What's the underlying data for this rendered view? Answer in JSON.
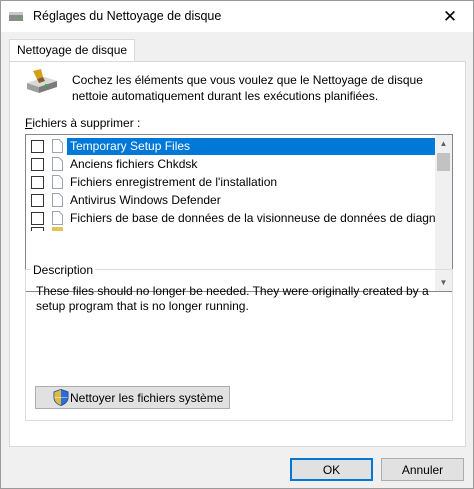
{
  "window": {
    "title": "Réglages du Nettoyage de disque",
    "close_glyph": "✕"
  },
  "tab": {
    "label": "Nettoyage de disque"
  },
  "intro": "Cochez les éléments que vous voulez que le Nettoyage de disque nettoie automatiquement durant les exécutions planifiées.",
  "files": {
    "label_prefix": "",
    "label_accel": "F",
    "label_rest": "ichiers à supprimer :",
    "items": [
      {
        "name": "Temporary Setup Files",
        "checked": false,
        "selected": true,
        "icon": "file-icon"
      },
      {
        "name": "Anciens fichiers Chkdsk",
        "checked": false,
        "selected": false,
        "icon": "file-icon"
      },
      {
        "name": "Fichiers enregistrement de l'installation",
        "checked": false,
        "selected": false,
        "icon": "file-icon"
      },
      {
        "name": "Antivirus Windows Defender",
        "checked": false,
        "selected": false,
        "icon": "file-icon"
      },
      {
        "name": "Fichiers de base de données de la visionneuse de données de diagn...",
        "checked": false,
        "selected": false,
        "icon": "file-icon"
      }
    ]
  },
  "description": {
    "legend": "Description",
    "text": "These files should no longer be needed. They were originally created by a setup program that is no longer running."
  },
  "system_button": {
    "label": "Nettoyer les fichiers système",
    "icon": "uac-shield-icon"
  },
  "footer": {
    "ok": "OK",
    "cancel": "Annuler"
  },
  "colors": {
    "selection": "#0078d7",
    "background": "#f0f0f0",
    "panel": "#ffffff"
  }
}
